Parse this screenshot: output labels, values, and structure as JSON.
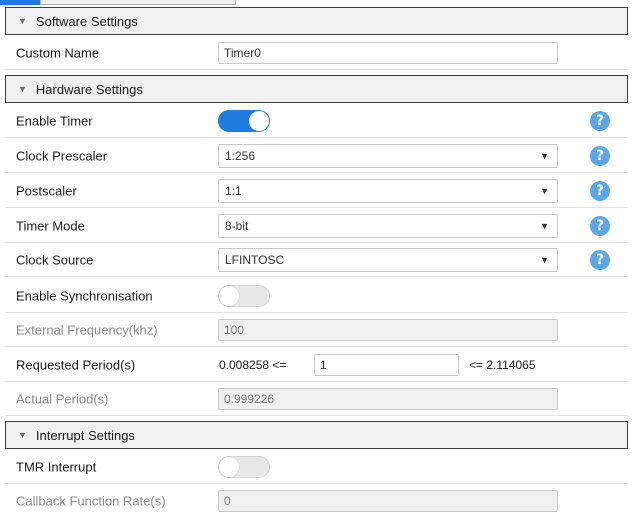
{
  "sections": {
    "software": "Software Settings",
    "hardware": "Hardware Settings",
    "interrupt": "Interrupt Settings"
  },
  "software": {
    "custom_name": {
      "label": "Custom Name",
      "value": "Timer0"
    }
  },
  "hardware": {
    "enable_timer": {
      "label": "Enable Timer",
      "state": "on"
    },
    "clock_prescaler": {
      "label": "Clock Prescaler",
      "value": "1:256"
    },
    "postscaler": {
      "label": "Postscaler",
      "value": "1:1"
    },
    "timer_mode": {
      "label": "Timer Mode",
      "value": "8-bit"
    },
    "clock_source": {
      "label": "Clock Source",
      "value": "LFINTOSC"
    },
    "enable_sync": {
      "label": "Enable Synchronisation",
      "state": "off"
    },
    "ext_freq": {
      "label": "External Frequency(khz)",
      "value": "100"
    },
    "requested_period": {
      "label": "Requested Period(s)",
      "min_text": "0.008258 <=",
      "value": "1",
      "max_text": "<= 2.114065"
    },
    "actual_period": {
      "label": "Actual Period(s)",
      "value": "0.999226"
    }
  },
  "interrupt": {
    "tmr_interrupt": {
      "label": "TMR Interrupt",
      "state": "off"
    },
    "callback_rate": {
      "label": "Callback Function Rate(s)",
      "value": "0"
    }
  },
  "icons": {
    "section_toggle": "triangle-down-icon",
    "help": "question-mark-icon",
    "dropdown": "chevron-down-icon"
  },
  "glyphs": {
    "triangle": "▼",
    "caret": "▼",
    "help": "?"
  },
  "colors": {
    "accent": "#1e7be0",
    "help": "#5aa6e6",
    "section_bg": "#f0f0f0",
    "readonly_bg": "#f0f0f0"
  }
}
